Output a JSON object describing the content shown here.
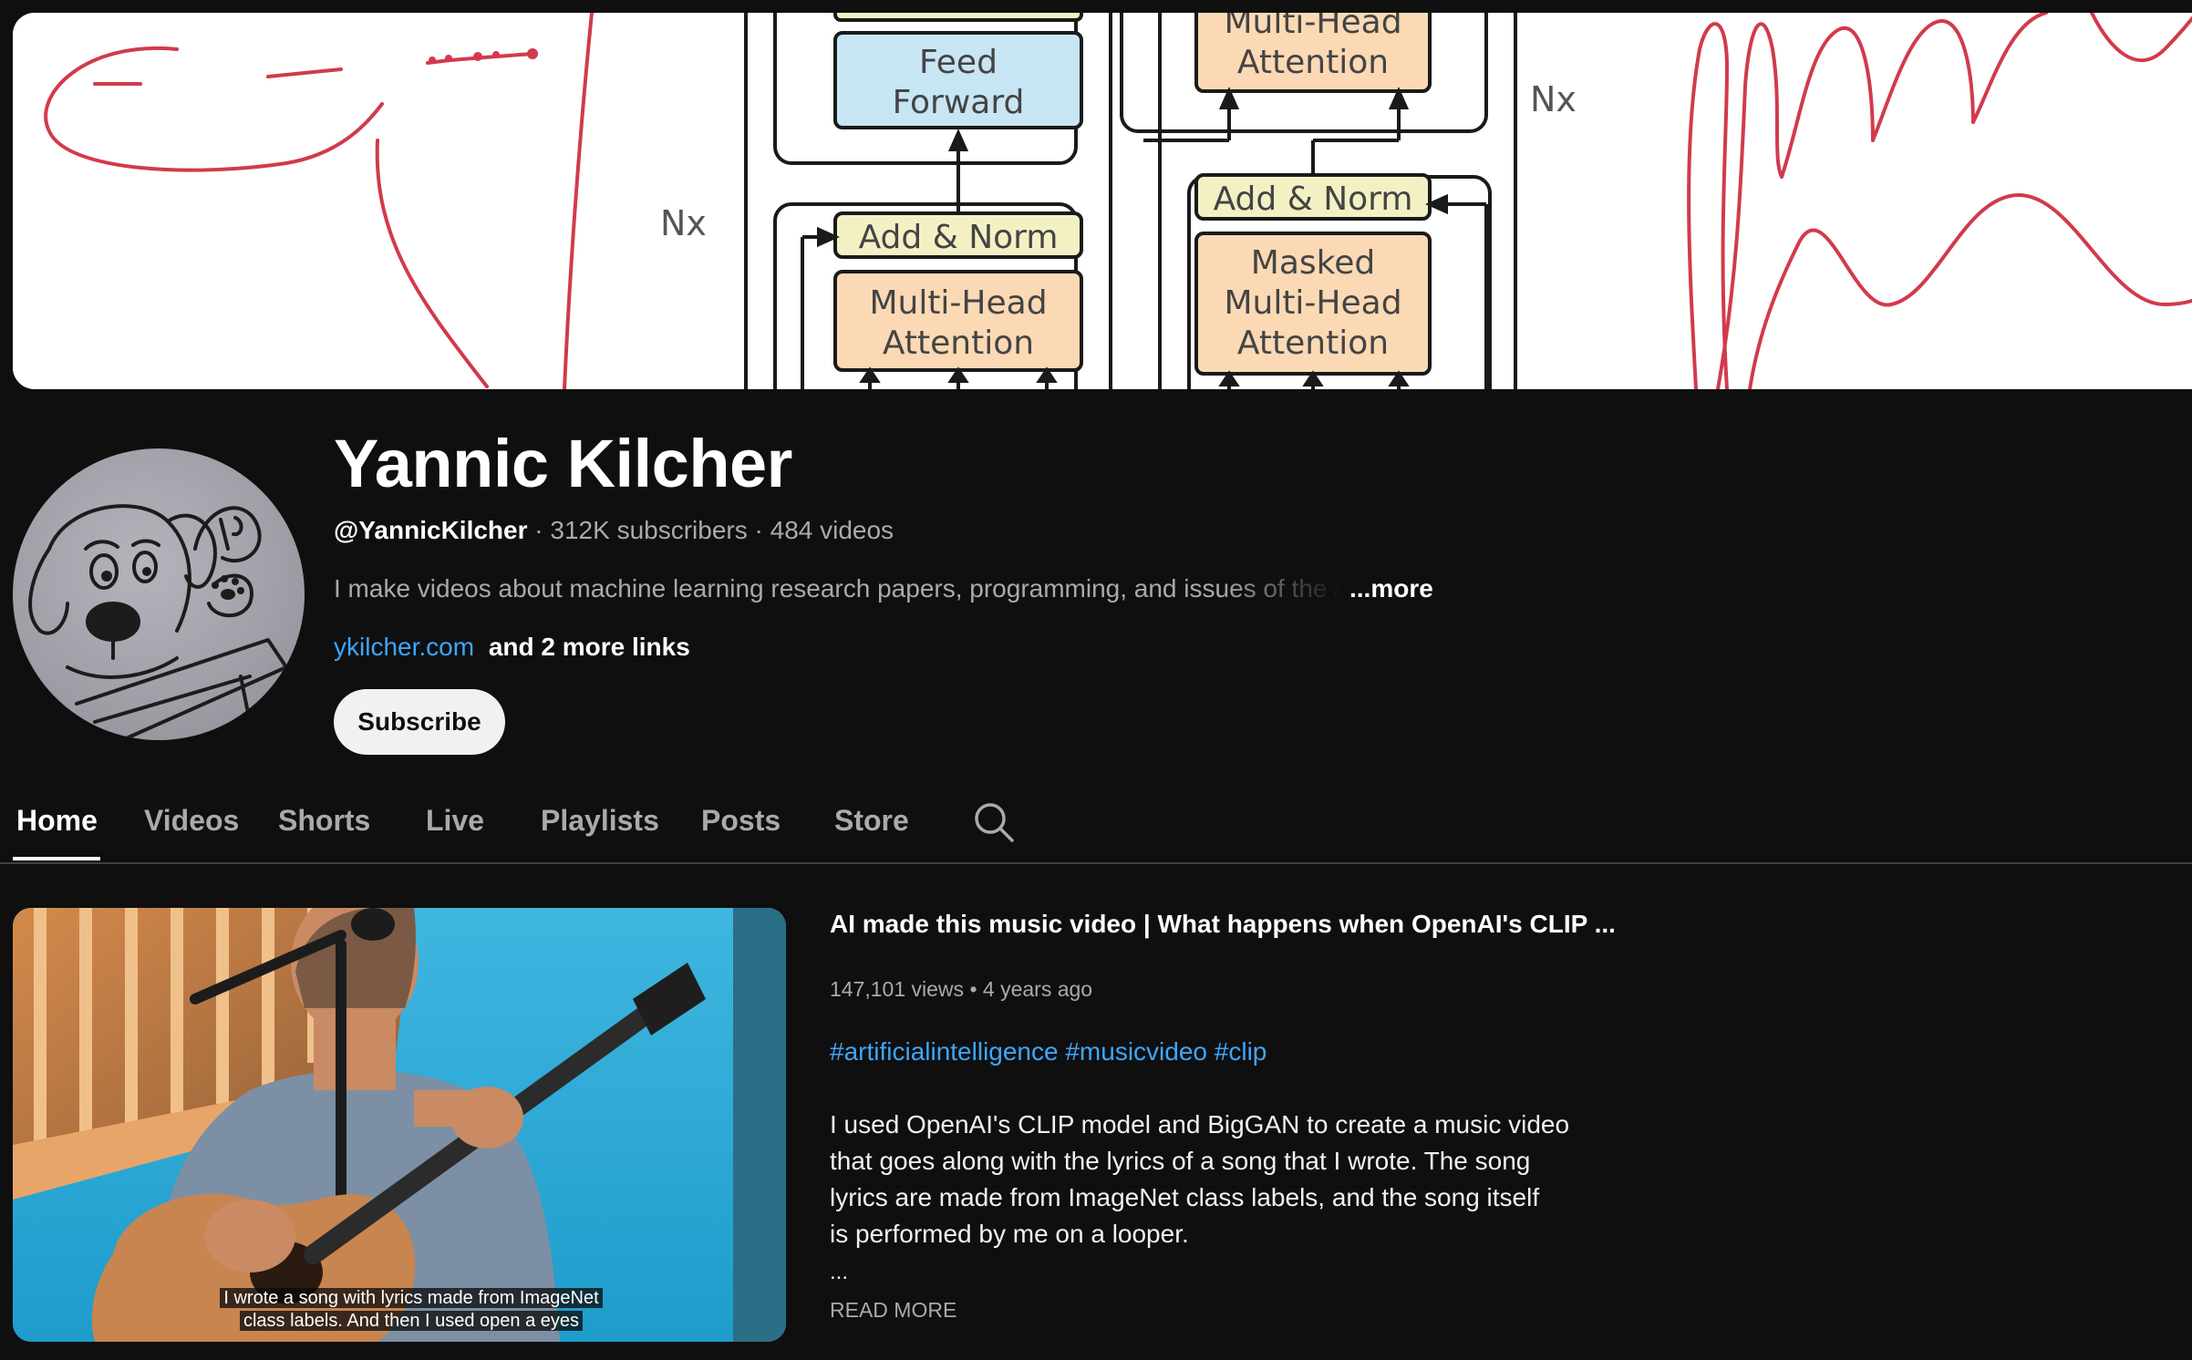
{
  "banner": {
    "labels": {
      "feed_forward_1": "Feed",
      "feed_forward_2": "Forward",
      "add_norm_enc": "Add & Norm",
      "mha_enc_1": "Multi-Head",
      "mha_enc_2": "Attention",
      "mha_dec_top_1": "Multi-Head",
      "mha_dec_top_2": "Attention",
      "add_norm_dec": "Add & Norm",
      "masked_1": "Masked",
      "masked_2": "Multi-Head",
      "masked_3": "Attention",
      "nx_left": "Nx",
      "nx_right": "Nx"
    }
  },
  "channel": {
    "name": "Yannic Kilcher",
    "handle": "@YannicKilcher",
    "subscribers": "312K subscribers",
    "videos": "484 videos",
    "separator": " · ",
    "description": "I make videos about machine learning research papers, programming, and issues of the AI",
    "more_label": "...more",
    "link": "ykilcher.com",
    "more_links": "and 2 more links",
    "subscribe_label": "Subscribe"
  },
  "tabs": [
    {
      "label": "Home",
      "active": true
    },
    {
      "label": "Videos"
    },
    {
      "label": "Shorts"
    },
    {
      "label": "Live"
    },
    {
      "label": "Playlists"
    },
    {
      "label": "Posts"
    },
    {
      "label": "Store"
    }
  ],
  "featured": {
    "title": "AI made this music video | What happens when OpenAI's CLIP ...",
    "views": "147,101 views",
    "dot": "•",
    "age": "4 years ago",
    "hashtags": [
      "#artificialintelligence",
      "#musicvideo",
      "#clip"
    ],
    "description_lines": [
      "I used OpenAI's CLIP model and BigGAN to create a music video",
      "that goes along with the lyrics of a song that I wrote. The song",
      "lyrics are made from ImageNet class labels, and the song itself",
      "is performed by me on a looper."
    ],
    "ellipsis": "...",
    "read_more": "READ MORE",
    "caption_line1": "I wrote a song with lyrics made from ImageNet",
    "caption_line2": "class labels. And then I used open a eyes"
  },
  "icons": {
    "search": "search-icon"
  },
  "colors": {
    "background": "#0f0f0f",
    "link": "#3ea6ff",
    "muted_text": "#aaaaaa",
    "ink_red": "#d23a4c"
  }
}
